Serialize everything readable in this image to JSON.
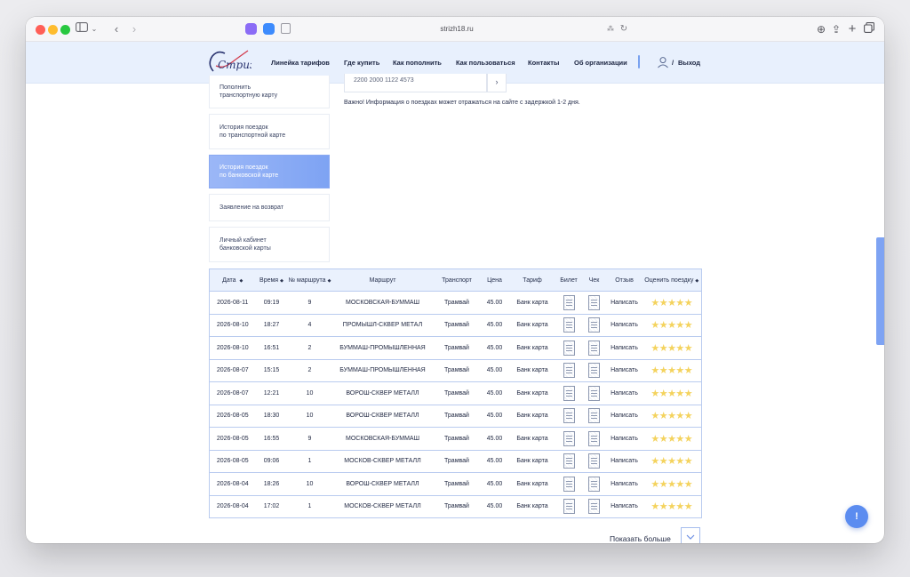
{
  "browser": {
    "url": "strizh18.ru"
  },
  "nav": {
    "items": [
      "Линейка тарифов",
      "Где купить",
      "Как пополнить",
      "Как пользоваться",
      "Контакты",
      "Об организации"
    ],
    "slash": "/",
    "logout": "Выход"
  },
  "logo": {
    "text": "Стриж"
  },
  "sidebar": {
    "items": [
      {
        "line1": "Пополнить",
        "line2": "транспортную карту"
      },
      {
        "line1": "История поездок",
        "line2": "по транспортной карте"
      },
      {
        "line1": "История поездок",
        "line2": "по банковской карте"
      },
      {
        "line1": "Заявление на возврат",
        "line2": ""
      },
      {
        "line1": "Личный кабинет",
        "line2": "банковской карты"
      }
    ]
  },
  "search": {
    "value": "2200 2000 1122 4573",
    "button": "›"
  },
  "notice": "Важно! Информация о поездках может отражаться на сайте с задержкой 1-2 дня.",
  "table": {
    "headers": [
      "Дата",
      "Время",
      "№ маршрута",
      "Маршрут",
      "Транспорт",
      "Цена",
      "Тариф",
      "Билет",
      "Чек",
      "Отзыв",
      "Оценить поездку"
    ],
    "sort_glyph": "◆",
    "rows": [
      {
        "date": "2026-08-11",
        "time": "09:19",
        "route_no": "9",
        "route": "МОСКОВСКАЯ-БУММАШ",
        "transport": "Трамвай",
        "price": "45.00",
        "tariff": "Банк карта",
        "review": "Написать",
        "rating": "★★★★★"
      },
      {
        "date": "2026-08-10",
        "time": "18:27",
        "route_no": "4",
        "route": "ПРОМЫШЛ-СКВЕР МЕТАЛ",
        "transport": "Трамвай",
        "price": "45.00",
        "tariff": "Банк карта",
        "review": "Написать",
        "rating": "★★★★★"
      },
      {
        "date": "2026-08-10",
        "time": "16:51",
        "route_no": "2",
        "route": "БУММАШ-ПРОМЫШЛЕННАЯ",
        "transport": "Трамвай",
        "price": "45.00",
        "tariff": "Банк карта",
        "review": "Написать",
        "rating": "★★★★★"
      },
      {
        "date": "2026-08-07",
        "time": "15:15",
        "route_no": "2",
        "route": "БУММАШ-ПРОМЫШЛЕННАЯ",
        "transport": "Трамвай",
        "price": "45.00",
        "tariff": "Банк карта",
        "review": "Написать",
        "rating": "★★★★★"
      },
      {
        "date": "2026-08-07",
        "time": "12:21",
        "route_no": "10",
        "route": "ВОРОШ-СКВЕР МЕТАЛЛ",
        "transport": "Трамвай",
        "price": "45.00",
        "tariff": "Банк карта",
        "review": "Написать",
        "rating": "★★★★★"
      },
      {
        "date": "2026-08-05",
        "time": "18:30",
        "route_no": "10",
        "route": "ВОРОШ-СКВЕР МЕТАЛЛ",
        "transport": "Трамвай",
        "price": "45.00",
        "tariff": "Банк карта",
        "review": "Написать",
        "rating": "★★★★★"
      },
      {
        "date": "2026-08-05",
        "time": "16:55",
        "route_no": "9",
        "route": "МОСКОВСКАЯ-БУММАШ",
        "transport": "Трамвай",
        "price": "45.00",
        "tariff": "Банк карта",
        "review": "Написать",
        "rating": "★★★★★"
      },
      {
        "date": "2026-08-05",
        "time": "09:06",
        "route_no": "1",
        "route": "МОСКОВ-СКВЕР МЕТАЛЛ",
        "transport": "Трамвай",
        "price": "45.00",
        "tariff": "Банк карта",
        "review": "Написать",
        "rating": "★★★★★"
      },
      {
        "date": "2026-08-04",
        "time": "18:26",
        "route_no": "10",
        "route": "ВОРОШ-СКВЕР МЕТАЛЛ",
        "transport": "Трамвай",
        "price": "45.00",
        "tariff": "Банк карта",
        "review": "Написать",
        "rating": "★★★★★"
      },
      {
        "date": "2026-08-04",
        "time": "17:02",
        "route_no": "1",
        "route": "МОСКОВ-СКВЕР МЕТАЛЛ",
        "transport": "Трамвай",
        "price": "45.00",
        "tariff": "Банк карта",
        "review": "Написать",
        "rating": "★★★★★"
      }
    ]
  },
  "show_more": {
    "label": "Показать больше",
    "icon": "chevron-down-icon"
  },
  "help": {
    "label": "!"
  },
  "colors": {
    "accent": "#7ea3f3",
    "header_bg": "#e8f0fd",
    "table_border": "#b9cbef",
    "star": "#f4d35e"
  }
}
